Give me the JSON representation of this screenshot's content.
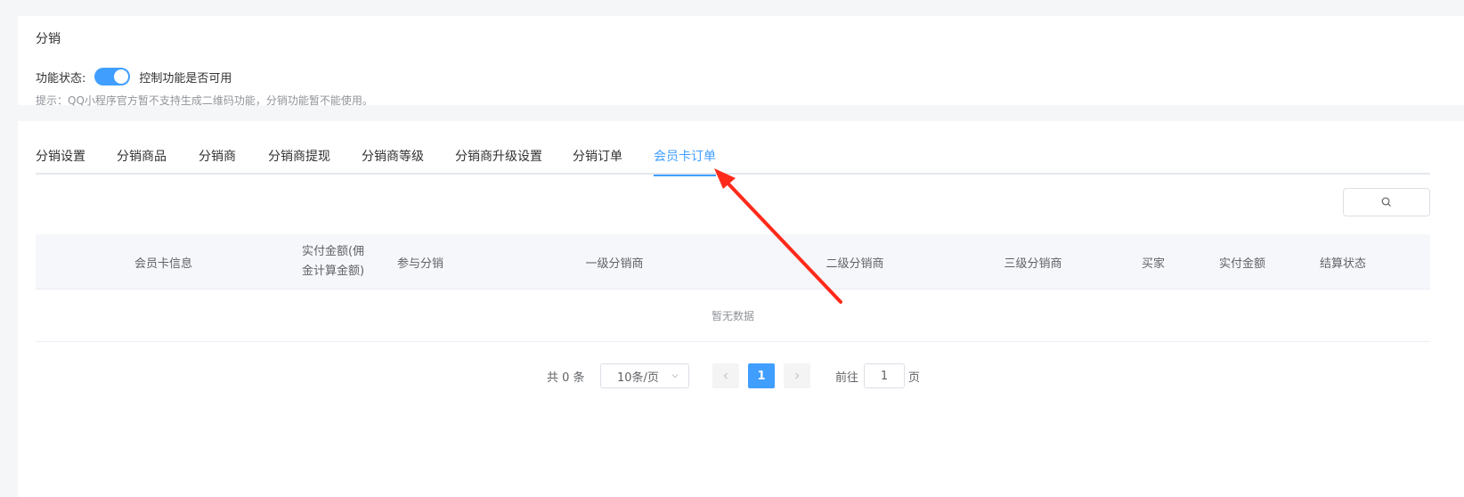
{
  "feature": {
    "title": "分销",
    "status_label": "功能状态:",
    "switch_on": true,
    "switch_desc": "控制功能是否可用",
    "hint": "提示：QQ小程序官方暂不支持生成二维码功能，分销功能暂不能使用。"
  },
  "tabs": [
    {
      "label": "分销设置"
    },
    {
      "label": "分销商品"
    },
    {
      "label": "分销商"
    },
    {
      "label": "分销商提现"
    },
    {
      "label": "分销商等级"
    },
    {
      "label": "分销商升级设置"
    },
    {
      "label": "分销订单"
    },
    {
      "label": "会员卡订单"
    }
  ],
  "active_tab": "会员卡订单",
  "search": {
    "icon": "search-icon"
  },
  "table": {
    "columns": [
      {
        "label": "会员卡信息"
      },
      {
        "label": "实付金额(佣金计算金额)"
      },
      {
        "label": "参与分销"
      },
      {
        "label": "一级分销商"
      },
      {
        "label": "二级分销商"
      },
      {
        "label": "三级分销商"
      },
      {
        "label": "买家"
      },
      {
        "label": "实付金额"
      },
      {
        "label": "结算状态"
      }
    ],
    "empty_text": "暂无数据"
  },
  "pagination": {
    "total_text": "共 0 条",
    "page_size": "10条/页",
    "current_page": "1",
    "goto_label": "前往",
    "goto_value": "1",
    "page_suffix": "页"
  },
  "colors": {
    "accent": "#409eff",
    "annotation_arrow": "#ff2a1a"
  }
}
